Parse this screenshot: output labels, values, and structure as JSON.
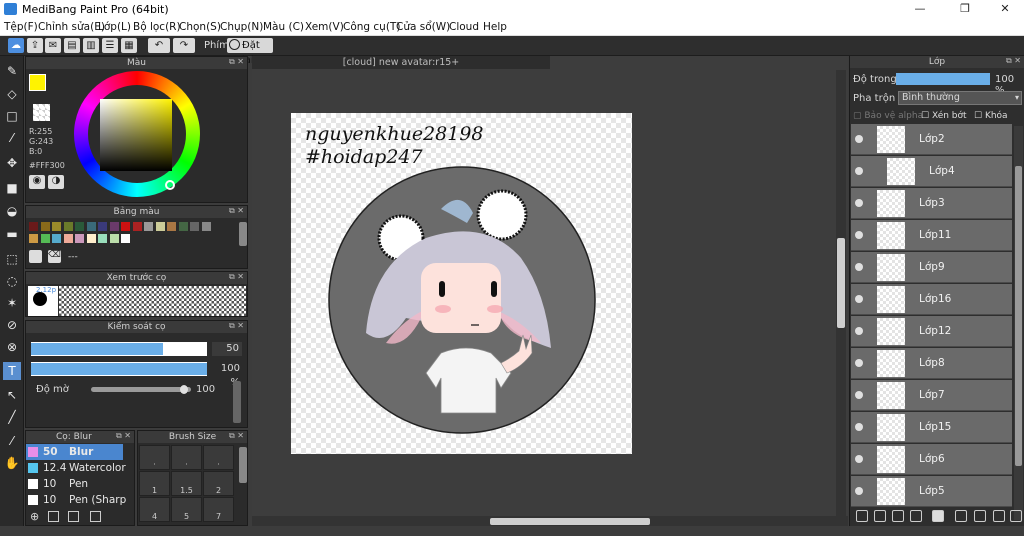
{
  "window": {
    "title": "MediBang Paint Pro (64bit)",
    "minimize": "—",
    "maximize": "❐",
    "close": "✕"
  },
  "menu": [
    "Tệp(F)",
    "Chỉnh sửa(E)",
    "Lớp(L)",
    "Bộ lọc(R)",
    "Chọn(S)",
    "Chụp(N)",
    "Màu (C)",
    "Xem(V)",
    "Công cụ(T)",
    "Cửa sổ(W)",
    "Cloud",
    "Help"
  ],
  "toolbar": {
    "shortcut_label": "Phím",
    "reset_label": "Đặt lại"
  },
  "color_panel": {
    "title": "Màu",
    "r": "R:255",
    "g": "G:243",
    "b": "B:0",
    "hex": "#FFF300",
    "primary": "#fff300",
    "secondary": "#ffffff"
  },
  "palette_panel": {
    "title": "Bảng màu",
    "dash": "---",
    "colors": [
      "#6a1a1a",
      "#8a6a1a",
      "#9a8a2a",
      "#6a7a2a",
      "#2a5a3a",
      "#3a6a7a",
      "#3a3a7a",
      "#6a3a6a",
      "#cc1111",
      "#aa2222",
      "#999999",
      "#cccc99",
      "#aa7744",
      "#446644",
      "#666666",
      "#888888",
      "#cc9944",
      "#55bb55",
      "#55aacc",
      "#eeaa99",
      "#cc99bb",
      "#ffeecc",
      "#99ddbb",
      "#bbddaa",
      "#ffffff"
    ]
  },
  "preview_panel": {
    "title": "Xem trước cọ",
    "size": "2.12p"
  },
  "brush_control": {
    "title": "Kiểm soát cọ",
    "size_value": "50",
    "size_fraction": 0.75,
    "opacity_value": "100 %",
    "opacity_fraction": 1.0,
    "blur_label": "Độ mờ",
    "blur_value": "100",
    "blur_fraction": 0.95
  },
  "brush_list": {
    "title": "Cọ: Blur",
    "items": [
      {
        "size": "50",
        "name": "Blur",
        "color": "#e88ee8",
        "selected": true
      },
      {
        "size": "12.4",
        "name": "Watercolor",
        "color": "#55c6ee",
        "selected": false
      },
      {
        "size": "10",
        "name": "Pen",
        "color": "#ffffff",
        "selected": false
      },
      {
        "size": "10",
        "name": "Pen (Sharp",
        "color": "#ffffff",
        "selected": false
      }
    ]
  },
  "brush_size": {
    "title": "Brush Size",
    "labels": [
      "·",
      "·",
      "·",
      "1",
      "1.5",
      "2",
      "4",
      "5",
      "7"
    ]
  },
  "document": {
    "tab": "[cloud] new avatar:r15+",
    "text_line1": "nguyenkhue28198",
    "text_line2": "#hoidap247"
  },
  "layer_panel": {
    "title": "Lớp",
    "opacity_label": "Độ trong",
    "opacity_value": "100 %",
    "blend_label": "Pha trộn",
    "blend_value": "Bình thường",
    "protect_alpha": "Bảo vệ alpha",
    "clip": "Xén bớt",
    "lock": "Khóa",
    "layers": [
      "Lớp2",
      "Lớp4",
      "Lớp3",
      "Lớp11",
      "Lớp9",
      "Lớp16",
      "Lớp12",
      "Lớp8",
      "Lớp7",
      "Lớp15",
      "Lớp6",
      "Lớp5"
    ]
  }
}
